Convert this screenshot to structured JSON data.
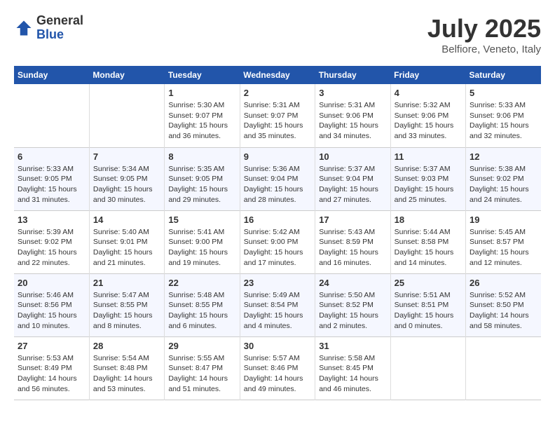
{
  "header": {
    "logo_general": "General",
    "logo_blue": "Blue",
    "month_title": "July 2025",
    "subtitle": "Belfiore, Veneto, Italy"
  },
  "days_of_week": [
    "Sunday",
    "Monday",
    "Tuesday",
    "Wednesday",
    "Thursday",
    "Friday",
    "Saturday"
  ],
  "weeks": [
    [
      {
        "day": "",
        "sunrise": "",
        "sunset": "",
        "daylight": ""
      },
      {
        "day": "",
        "sunrise": "",
        "sunset": "",
        "daylight": ""
      },
      {
        "day": "1",
        "sunrise": "Sunrise: 5:30 AM",
        "sunset": "Sunset: 9:07 PM",
        "daylight": "Daylight: 15 hours and 36 minutes."
      },
      {
        "day": "2",
        "sunrise": "Sunrise: 5:31 AM",
        "sunset": "Sunset: 9:07 PM",
        "daylight": "Daylight: 15 hours and 35 minutes."
      },
      {
        "day": "3",
        "sunrise": "Sunrise: 5:31 AM",
        "sunset": "Sunset: 9:06 PM",
        "daylight": "Daylight: 15 hours and 34 minutes."
      },
      {
        "day": "4",
        "sunrise": "Sunrise: 5:32 AM",
        "sunset": "Sunset: 9:06 PM",
        "daylight": "Daylight: 15 hours and 33 minutes."
      },
      {
        "day": "5",
        "sunrise": "Sunrise: 5:33 AM",
        "sunset": "Sunset: 9:06 PM",
        "daylight": "Daylight: 15 hours and 32 minutes."
      }
    ],
    [
      {
        "day": "6",
        "sunrise": "Sunrise: 5:33 AM",
        "sunset": "Sunset: 9:05 PM",
        "daylight": "Daylight: 15 hours and 31 minutes."
      },
      {
        "day": "7",
        "sunrise": "Sunrise: 5:34 AM",
        "sunset": "Sunset: 9:05 PM",
        "daylight": "Daylight: 15 hours and 30 minutes."
      },
      {
        "day": "8",
        "sunrise": "Sunrise: 5:35 AM",
        "sunset": "Sunset: 9:05 PM",
        "daylight": "Daylight: 15 hours and 29 minutes."
      },
      {
        "day": "9",
        "sunrise": "Sunrise: 5:36 AM",
        "sunset": "Sunset: 9:04 PM",
        "daylight": "Daylight: 15 hours and 28 minutes."
      },
      {
        "day": "10",
        "sunrise": "Sunrise: 5:37 AM",
        "sunset": "Sunset: 9:04 PM",
        "daylight": "Daylight: 15 hours and 27 minutes."
      },
      {
        "day": "11",
        "sunrise": "Sunrise: 5:37 AM",
        "sunset": "Sunset: 9:03 PM",
        "daylight": "Daylight: 15 hours and 25 minutes."
      },
      {
        "day": "12",
        "sunrise": "Sunrise: 5:38 AM",
        "sunset": "Sunset: 9:02 PM",
        "daylight": "Daylight: 15 hours and 24 minutes."
      }
    ],
    [
      {
        "day": "13",
        "sunrise": "Sunrise: 5:39 AM",
        "sunset": "Sunset: 9:02 PM",
        "daylight": "Daylight: 15 hours and 22 minutes."
      },
      {
        "day": "14",
        "sunrise": "Sunrise: 5:40 AM",
        "sunset": "Sunset: 9:01 PM",
        "daylight": "Daylight: 15 hours and 21 minutes."
      },
      {
        "day": "15",
        "sunrise": "Sunrise: 5:41 AM",
        "sunset": "Sunset: 9:00 PM",
        "daylight": "Daylight: 15 hours and 19 minutes."
      },
      {
        "day": "16",
        "sunrise": "Sunrise: 5:42 AM",
        "sunset": "Sunset: 9:00 PM",
        "daylight": "Daylight: 15 hours and 17 minutes."
      },
      {
        "day": "17",
        "sunrise": "Sunrise: 5:43 AM",
        "sunset": "Sunset: 8:59 PM",
        "daylight": "Daylight: 15 hours and 16 minutes."
      },
      {
        "day": "18",
        "sunrise": "Sunrise: 5:44 AM",
        "sunset": "Sunset: 8:58 PM",
        "daylight": "Daylight: 15 hours and 14 minutes."
      },
      {
        "day": "19",
        "sunrise": "Sunrise: 5:45 AM",
        "sunset": "Sunset: 8:57 PM",
        "daylight": "Daylight: 15 hours and 12 minutes."
      }
    ],
    [
      {
        "day": "20",
        "sunrise": "Sunrise: 5:46 AM",
        "sunset": "Sunset: 8:56 PM",
        "daylight": "Daylight: 15 hours and 10 minutes."
      },
      {
        "day": "21",
        "sunrise": "Sunrise: 5:47 AM",
        "sunset": "Sunset: 8:55 PM",
        "daylight": "Daylight: 15 hours and 8 minutes."
      },
      {
        "day": "22",
        "sunrise": "Sunrise: 5:48 AM",
        "sunset": "Sunset: 8:55 PM",
        "daylight": "Daylight: 15 hours and 6 minutes."
      },
      {
        "day": "23",
        "sunrise": "Sunrise: 5:49 AM",
        "sunset": "Sunset: 8:54 PM",
        "daylight": "Daylight: 15 hours and 4 minutes."
      },
      {
        "day": "24",
        "sunrise": "Sunrise: 5:50 AM",
        "sunset": "Sunset: 8:52 PM",
        "daylight": "Daylight: 15 hours and 2 minutes."
      },
      {
        "day": "25",
        "sunrise": "Sunrise: 5:51 AM",
        "sunset": "Sunset: 8:51 PM",
        "daylight": "Daylight: 15 hours and 0 minutes."
      },
      {
        "day": "26",
        "sunrise": "Sunrise: 5:52 AM",
        "sunset": "Sunset: 8:50 PM",
        "daylight": "Daylight: 14 hours and 58 minutes."
      }
    ],
    [
      {
        "day": "27",
        "sunrise": "Sunrise: 5:53 AM",
        "sunset": "Sunset: 8:49 PM",
        "daylight": "Daylight: 14 hours and 56 minutes."
      },
      {
        "day": "28",
        "sunrise": "Sunrise: 5:54 AM",
        "sunset": "Sunset: 8:48 PM",
        "daylight": "Daylight: 14 hours and 53 minutes."
      },
      {
        "day": "29",
        "sunrise": "Sunrise: 5:55 AM",
        "sunset": "Sunset: 8:47 PM",
        "daylight": "Daylight: 14 hours and 51 minutes."
      },
      {
        "day": "30",
        "sunrise": "Sunrise: 5:57 AM",
        "sunset": "Sunset: 8:46 PM",
        "daylight": "Daylight: 14 hours and 49 minutes."
      },
      {
        "day": "31",
        "sunrise": "Sunrise: 5:58 AM",
        "sunset": "Sunset: 8:45 PM",
        "daylight": "Daylight: 14 hours and 46 minutes."
      },
      {
        "day": "",
        "sunrise": "",
        "sunset": "",
        "daylight": ""
      },
      {
        "day": "",
        "sunrise": "",
        "sunset": "",
        "daylight": ""
      }
    ]
  ]
}
